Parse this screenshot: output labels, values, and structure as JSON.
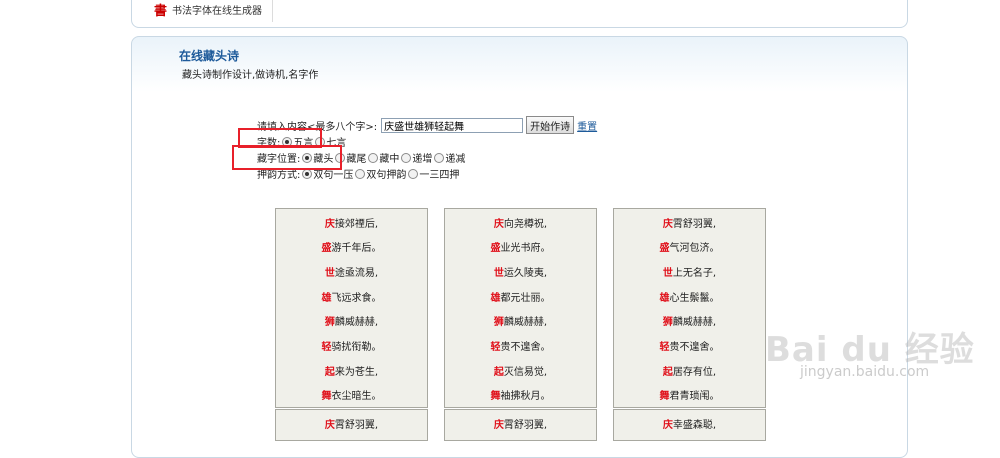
{
  "header": {
    "logo": "書",
    "title": "书法字体在线生成器"
  },
  "section": {
    "title": "在线藏头诗",
    "subtitle": "藏头诗制作设计,做诗机,名字作"
  },
  "form": {
    "input_label": "请填入内容<最多八个字>:",
    "input_value": "庆盛世雄狮轻起舞",
    "submit_label": "开始作诗",
    "reset_label": "重置",
    "length_label": "字数:",
    "length_options": [
      {
        "label": "五言",
        "checked": true
      },
      {
        "label": "七言",
        "checked": false
      }
    ],
    "position_label": "藏字位置:",
    "position_options": [
      {
        "label": "藏头",
        "checked": true
      },
      {
        "label": "藏尾",
        "checked": false
      },
      {
        "label": "藏中",
        "checked": false
      },
      {
        "label": "递增",
        "checked": false
      },
      {
        "label": "递减",
        "checked": false
      }
    ],
    "rhyme_label": "押韵方式:",
    "rhyme_options": [
      {
        "label": "双句一压",
        "checked": true
      },
      {
        "label": "双句押韵",
        "checked": false
      },
      {
        "label": "一三四押",
        "checked": false
      }
    ]
  },
  "poems": [
    {
      "lines": [
        {
          "first": "庆",
          "rest": "接郊禋后,"
        },
        {
          "first": "盛",
          "rest": "游千年后。"
        },
        {
          "first": "世",
          "rest": "途亟流易,"
        },
        {
          "first": "雄",
          "rest": "飞远求食。"
        },
        {
          "first": "狮",
          "rest": "麟威赫赫,"
        },
        {
          "first": "轻",
          "rest": "骑扰衔勒。"
        },
        {
          "first": "起",
          "rest": "来为苍生,"
        },
        {
          "first": "舞",
          "rest": "衣尘暗生。"
        }
      ]
    },
    {
      "lines": [
        {
          "first": "庆",
          "rest": "向尧樽祝,"
        },
        {
          "first": "盛",
          "rest": "业光书府。"
        },
        {
          "first": "世",
          "rest": "运久陵夷,"
        },
        {
          "first": "雄",
          "rest": "都元壮丽。"
        },
        {
          "first": "狮",
          "rest": "麟威赫赫,"
        },
        {
          "first": "轻",
          "rest": "贵不遑舍。"
        },
        {
          "first": "起",
          "rest": "灭信易觉,"
        },
        {
          "first": "舞",
          "rest": "袖拂秋月。"
        }
      ]
    },
    {
      "lines": [
        {
          "first": "庆",
          "rest": "霄舒羽翼,"
        },
        {
          "first": "盛",
          "rest": "气河包济。"
        },
        {
          "first": "世",
          "rest": "上无名子,"
        },
        {
          "first": "雄",
          "rest": "心生鬃鬣。"
        },
        {
          "first": "狮",
          "rest": "麟威赫赫,"
        },
        {
          "first": "轻",
          "rest": "贵不遑舍。"
        },
        {
          "first": "起",
          "rest": "居存有位,"
        },
        {
          "first": "舞",
          "rest": "君青琐闱。"
        }
      ]
    }
  ],
  "poems_row2": [
    {
      "first": "庆",
      "rest": "霄舒羽翼,"
    },
    {
      "first": "庆",
      "rest": "霄舒羽翼,"
    },
    {
      "first": "庆",
      "rest": "幸盛森聪,"
    }
  ],
  "watermark": {
    "text": "Bai du 经验",
    "sub": "jingyan.baidu.com"
  }
}
